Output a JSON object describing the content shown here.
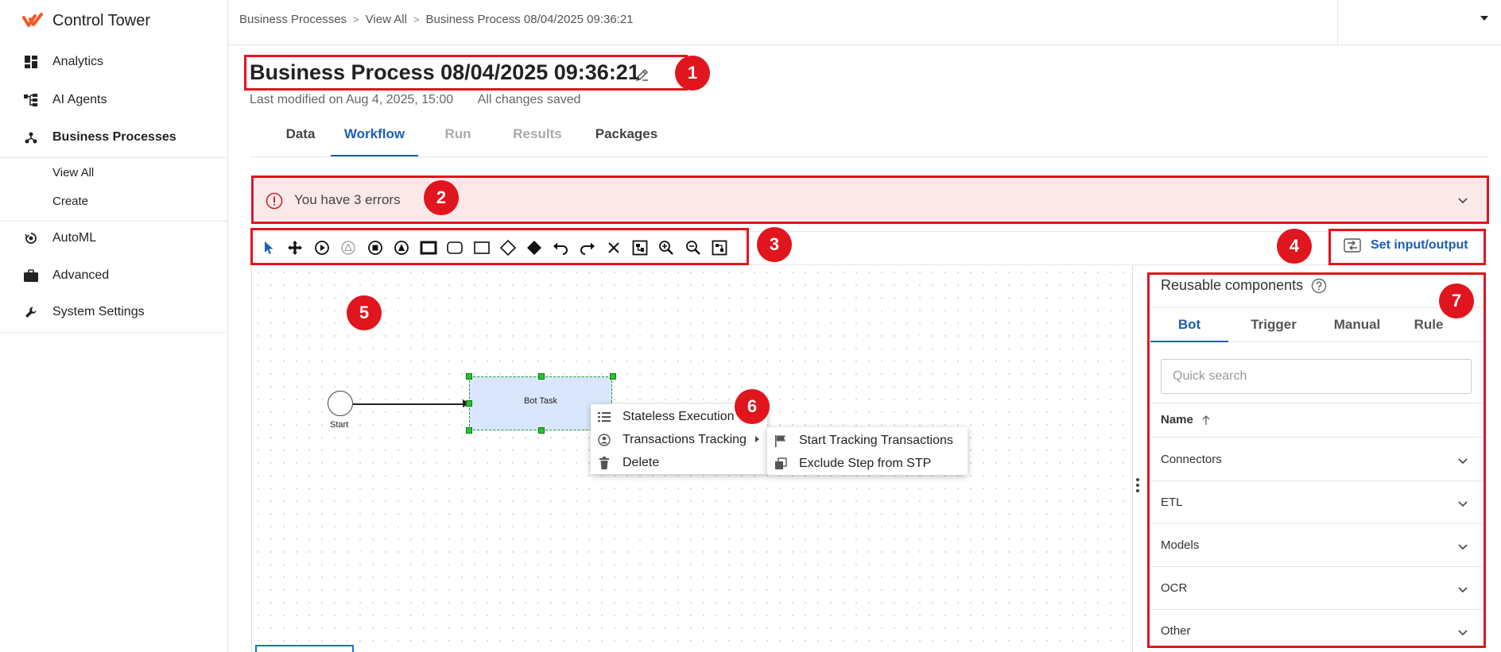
{
  "app": {
    "name": "Control Tower"
  },
  "sidebar": {
    "items": [
      {
        "label": "Analytics",
        "icon": "dashboard-icon"
      },
      {
        "label": "AI Agents",
        "icon": "hierarchy-icon"
      },
      {
        "label": "Business Processes",
        "icon": "process-icon",
        "active": true
      },
      {
        "label": "AutoML",
        "icon": "automl-icon"
      },
      {
        "label": "Advanced",
        "icon": "briefcase-icon"
      },
      {
        "label": "System Settings",
        "icon": "wrench-icon"
      }
    ],
    "subitems": [
      "View All",
      "Create"
    ]
  },
  "breadcrumb": [
    "Business Processes",
    "View All",
    "Business Process 08/04/2025 09:36:21"
  ],
  "page": {
    "title": "Business Process 08/04/2025 09:36:21",
    "last_modified": "Last modified on Aug 4, 2025, 15:00",
    "save_status": "All changes saved"
  },
  "tabs": [
    {
      "label": "Data",
      "state": "normal"
    },
    {
      "label": "Workflow",
      "state": "active"
    },
    {
      "label": "Run",
      "state": "disabled"
    },
    {
      "label": "Results",
      "state": "disabled"
    },
    {
      "label": "Packages",
      "state": "normal"
    }
  ],
  "errors": {
    "text": "You have 3 errors"
  },
  "toolbar": {
    "tools": [
      "pointer-icon",
      "pan-icon",
      "start-event-icon",
      "intermediate-event-icon",
      "end-event-icon",
      "escalation-event-icon",
      "bold-task-icon",
      "rounded-task-icon",
      "task-icon",
      "gateway-icon",
      "filled-gateway-icon",
      "undo-icon",
      "redo-icon",
      "delete-icon",
      "fit-icon",
      "zoom-in-icon",
      "zoom-out-icon",
      "minimap-icon"
    ],
    "set_io_label": "Set input/output"
  },
  "canvas": {
    "start_label": "Start",
    "task_label": "Bot Task"
  },
  "context_menu": {
    "items": [
      "Stateless Execution",
      "Transactions Tracking",
      "Delete"
    ],
    "submenu": [
      "Start Tracking Transactions",
      "Exclude Step from STP"
    ]
  },
  "panel": {
    "title": "Reusable components",
    "tabs": [
      "Bot",
      "Trigger",
      "Manual",
      "Rule"
    ],
    "search_placeholder": "Quick search",
    "column": "Name",
    "groups": [
      "Connectors",
      "ETL",
      "Models",
      "OCR",
      "Other"
    ]
  },
  "annotations": [
    "1",
    "2",
    "3",
    "4",
    "5",
    "6",
    "7"
  ],
  "colors": {
    "accent": "#1a5fb4",
    "annotation": "#e0151e",
    "error_bg": "#fbe9ea",
    "brand": "#f15a24"
  }
}
